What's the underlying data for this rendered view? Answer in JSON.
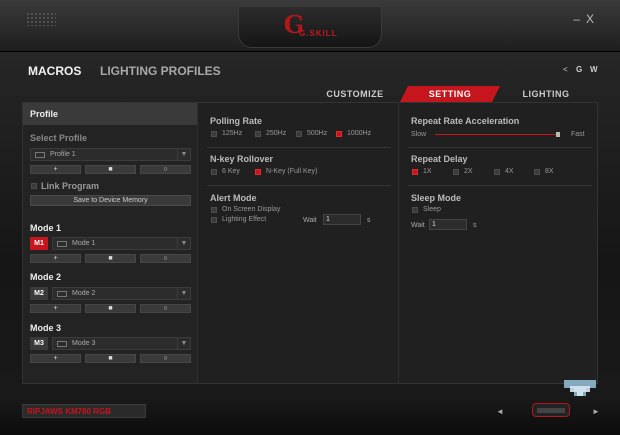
{
  "window": {
    "minimize": "–",
    "close": "X"
  },
  "brand": {
    "logo_text": "G.SKILL"
  },
  "nav": {
    "macros": "MACROS",
    "lighting_profiles": "LIGHTING PROFILES",
    "g": "G",
    "w": "W"
  },
  "tabs": [
    {
      "label": "CUSTOMIZE"
    },
    {
      "label": "SETTING"
    },
    {
      "label": "LIGHTING"
    }
  ],
  "left": {
    "title": "Profile",
    "select_profile": "Select Profile",
    "profile_value": "Profile 1",
    "link_program": "Link Program",
    "save_button": "Save to Device Memory",
    "buttons": {
      "add": "+",
      "save": "■",
      "reset": "○"
    },
    "modes": [
      {
        "title": "Mode 1",
        "badge": "M1",
        "value": "Mode 1"
      },
      {
        "title": "Mode 2",
        "badge": "M2",
        "value": "Mode 2"
      },
      {
        "title": "Mode 3",
        "badge": "M3",
        "value": "Mode 3"
      }
    ]
  },
  "polling": {
    "title": "Polling Rate",
    "options": [
      "125Hz",
      "250Hz",
      "500Hz",
      "1000Hz"
    ],
    "selected": "1000Hz"
  },
  "nkey": {
    "title": "N-key Rollover",
    "options": [
      "6 Key",
      "N-Key (Full Key)"
    ],
    "selected": "N-Key (Full Key)"
  },
  "alert": {
    "title": "Alert Mode",
    "options": [
      "On Screen Display",
      "Lighting Effect"
    ],
    "wait_label": "Wait",
    "wait_value": "1",
    "unit": "s"
  },
  "repeat_accel": {
    "title": "Repeat Rate Acceleration",
    "slow": "Slow",
    "fast": "Fast"
  },
  "repeat_delay": {
    "title": "Repeat Delay",
    "options": [
      "1X",
      "2X",
      "4X",
      "8X"
    ],
    "selected": "1X"
  },
  "sleep": {
    "title": "Sleep Mode",
    "option": "Sleep",
    "wait_label": "Wait",
    "wait_value": "1",
    "unit": "s"
  },
  "footer": {
    "model": "RIPJAWS KM780 RGB",
    "prev": "◄",
    "next": "►"
  },
  "colors": {
    "accent": "#c4161c",
    "background": "#202020"
  }
}
